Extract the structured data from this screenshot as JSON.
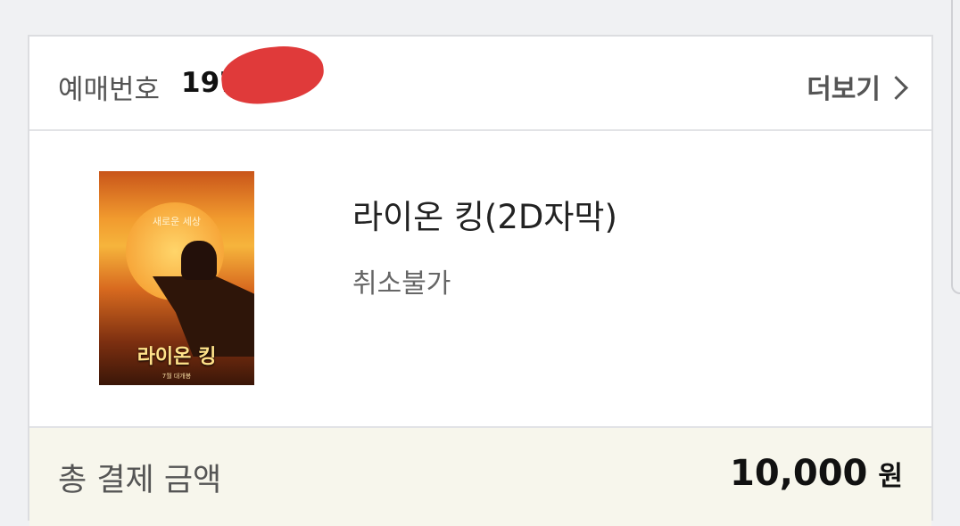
{
  "header": {
    "booking_label": "예매번호",
    "booking_number": "1972",
    "more_label": "더보기"
  },
  "movie": {
    "title": "라이온 킹(2D자막)",
    "status": "취소불가",
    "poster": {
      "tagline": "새로운 세상",
      "title_text": "라이온 킹",
      "release_text": "7월 대개봉"
    }
  },
  "payment": {
    "total_label": "총 결제 금액",
    "amount": "10,000",
    "currency": "원"
  },
  "icons": {
    "more": "chevron-right-icon"
  },
  "colors": {
    "footer_bg": "#f7f6ec",
    "redaction": "#e03a3a"
  }
}
